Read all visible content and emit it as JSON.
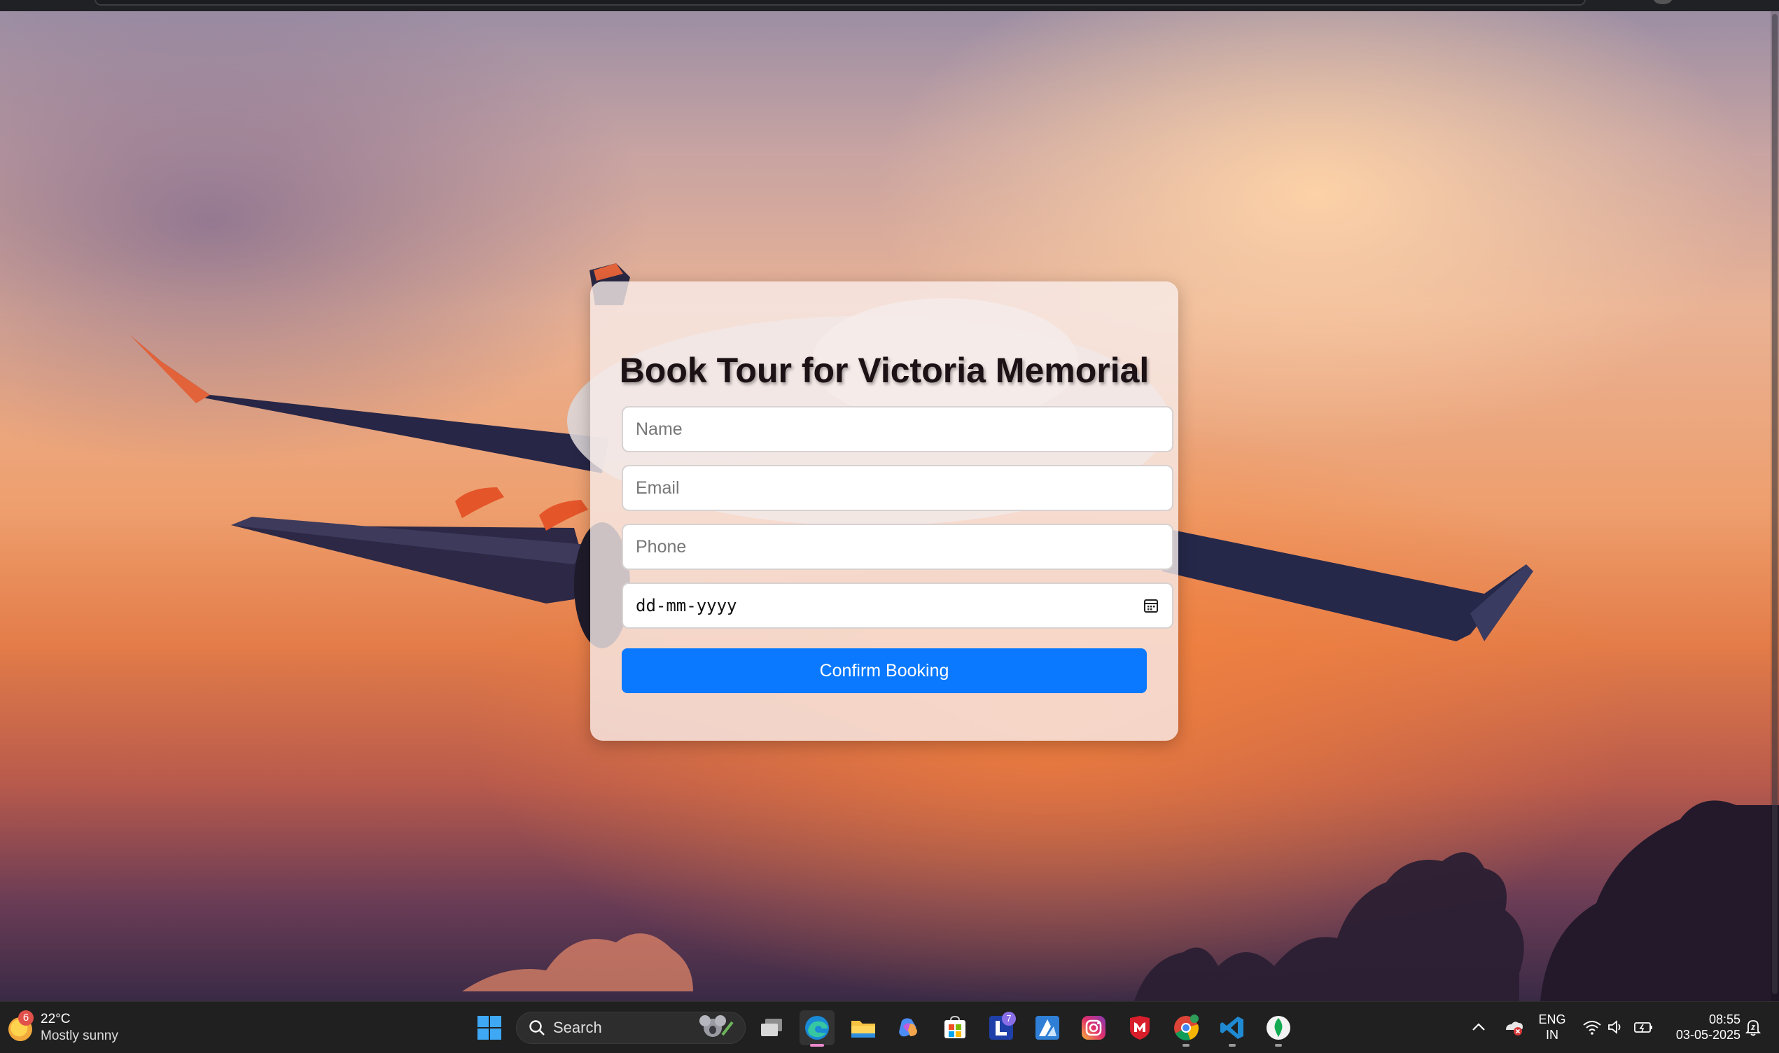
{
  "booking": {
    "title": "Book Tour for Victoria Memorial",
    "name_placeholder": "Name",
    "email_placeholder": "Email",
    "phone_placeholder": "Phone",
    "date_placeholder": "dd-mm-yyyy",
    "confirm_label": "Confirm Booking"
  },
  "colors": {
    "button": "#0a79ff",
    "card": "rgba(248,236,234,0.80)"
  },
  "taskbar": {
    "weather": {
      "badge": "6",
      "temperature": "22°C",
      "condition": "Mostly sunny",
      "icon": "sun-icon"
    },
    "search_label": "Search",
    "apps": [
      {
        "name": "windows-start-icon"
      },
      {
        "name": "task-view-icon"
      },
      {
        "name": "edge-icon",
        "active": true
      },
      {
        "name": "file-explorer-icon"
      },
      {
        "name": "copilot-icon"
      },
      {
        "name": "microsoft-store-icon"
      },
      {
        "name": "lexicon-app-icon",
        "badge": "7"
      },
      {
        "name": "azure-icon"
      },
      {
        "name": "instagram-icon"
      },
      {
        "name": "mcafee-icon"
      },
      {
        "name": "chrome-icon"
      },
      {
        "name": "vscode-icon"
      },
      {
        "name": "mongodb-compass-icon"
      }
    ],
    "tray": {
      "language": "ENG",
      "region": "IN",
      "time": "08:55",
      "date": "03-05-2025"
    }
  }
}
